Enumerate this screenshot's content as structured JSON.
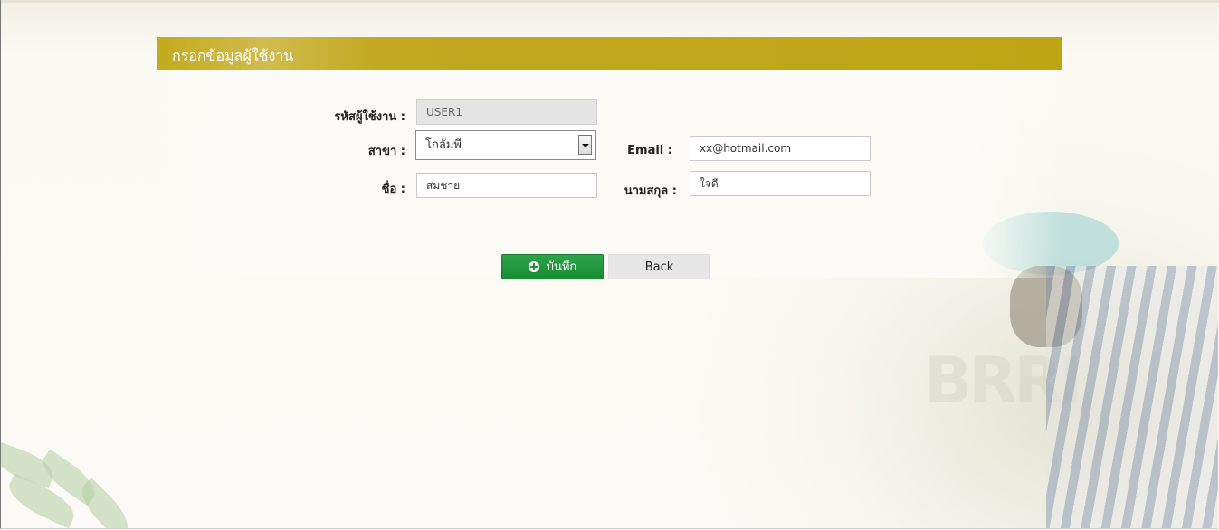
{
  "form": {
    "title": "กรอกข้อมูลผู้ใช้งาน",
    "user_code": {
      "label": "รหัสผู้ใช้งาน :",
      "value": "USER1"
    },
    "branch": {
      "label": "สาขา :",
      "value": "โกลัมพี"
    },
    "email": {
      "label": "Email :",
      "value": "xx@hotmail.com"
    },
    "first_name": {
      "label": "ชื่อ :",
      "value": "สมชาย"
    },
    "last_name": {
      "label": "นามสกุล :",
      "value": "ใจดี"
    }
  },
  "actions": {
    "save_label": "บันทึก",
    "back_label": "Back"
  },
  "background": {
    "watermark": "BRRI"
  },
  "colors": {
    "header_bar": "#c3a921",
    "save_button": "#1f9639",
    "back_button": "#e6e6e6"
  }
}
